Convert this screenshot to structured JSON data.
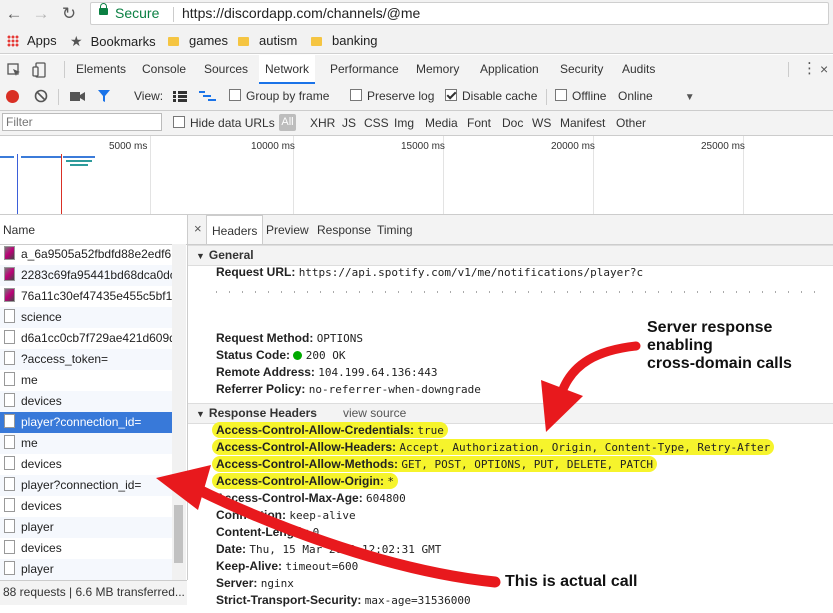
{
  "browser": {
    "secure_label": "Secure",
    "url": "https://discordapp.com/channels/@me"
  },
  "bookmarks": [
    "Apps",
    "Bookmarks",
    "games",
    "autism",
    "banking"
  ],
  "devtools": {
    "tabs": [
      "Elements",
      "Console",
      "Sources",
      "Network",
      "Performance",
      "Memory",
      "Application",
      "Security",
      "Audits"
    ],
    "active_tab": "Network"
  },
  "toolbar": {
    "view_label": "View:",
    "group_by_frame": "Group by frame",
    "preserve_log": "Preserve log",
    "disable_cache": "Disable cache",
    "offline": "Offline",
    "online": "Online"
  },
  "filter": {
    "placeholder": "Filter",
    "hide_data_urls": "Hide data URLs",
    "all": "All",
    "types": [
      "XHR",
      "JS",
      "CSS",
      "Img",
      "Media",
      "Font",
      "Doc",
      "WS",
      "Manifest",
      "Other"
    ]
  },
  "timeline": {
    "ticks": [
      "5000 ms",
      "10000 ms",
      "15000 ms",
      "20000 ms",
      "25000 ms"
    ]
  },
  "requests": {
    "header": "Name",
    "rows": [
      "a_6a9505a52fbdfd88e2edf6",
      "2283c69fa95441bd68dca0dc",
      "76a11c30ef47435e455c5bf1.",
      "science",
      "d6a1cc0cb7f729ae421d609d",
      "?access_token=",
      "me",
      "devices",
      "player?connection_id=",
      "me",
      "devices",
      "player?connection_id=",
      "devices",
      "player",
      "devices",
      "player"
    ],
    "selected_index": 8,
    "status": "88 requests | 6.6 MB transferred..."
  },
  "detail": {
    "tabs": [
      "Headers",
      "Preview",
      "Response",
      "Timing"
    ],
    "general_title": "General",
    "request_url_label": "Request URL:",
    "request_url_value": "https://api.spotify.com/v1/me/notifications/player?c",
    "request_method_label": "Request Method:",
    "request_method_value": "OPTIONS",
    "status_code_label": "Status Code:",
    "status_code_value": "200 OK",
    "remote_address_label": "Remote Address:",
    "remote_address_value": "104.199.64.136:443",
    "referrer_policy_label": "Referrer Policy:",
    "referrer_policy_value": "no-referrer-when-downgrade",
    "response_headers_title": "Response Headers",
    "view_source": "view source",
    "headers": [
      {
        "k": "Access-Control-Allow-Credentials:",
        "v": "true"
      },
      {
        "k": "Access-Control-Allow-Headers:",
        "v": "Accept, Authorization, Origin, Content-Type, Retry-After"
      },
      {
        "k": "Access-Control-Allow-Methods:",
        "v": "GET, POST, OPTIONS, PUT, DELETE, PATCH"
      },
      {
        "k": "Access-Control-Allow-Origin:",
        "v": "*"
      },
      {
        "k": "Access-Control-Max-Age:",
        "v": "604800"
      },
      {
        "k": "Connection:",
        "v": "keep-alive"
      },
      {
        "k": "Content-Length:",
        "v": "0"
      },
      {
        "k": "Date:",
        "v": "Thu, 15 Mar 2018 12:02:31 GMT"
      },
      {
        "k": "Keep-Alive:",
        "v": "timeout=600"
      },
      {
        "k": "Server:",
        "v": "nginx"
      },
      {
        "k": "Strict-Transport-Security:",
        "v": "max-age=31536000"
      }
    ]
  },
  "annotations": {
    "server": "Server response\nenabling\ncross-domain calls",
    "call": "This is actual call"
  },
  "colors": {
    "highlight": "#f6f42c",
    "arrow": "#e8191d",
    "selected_row": "#3879d9",
    "record": "#d93025"
  }
}
